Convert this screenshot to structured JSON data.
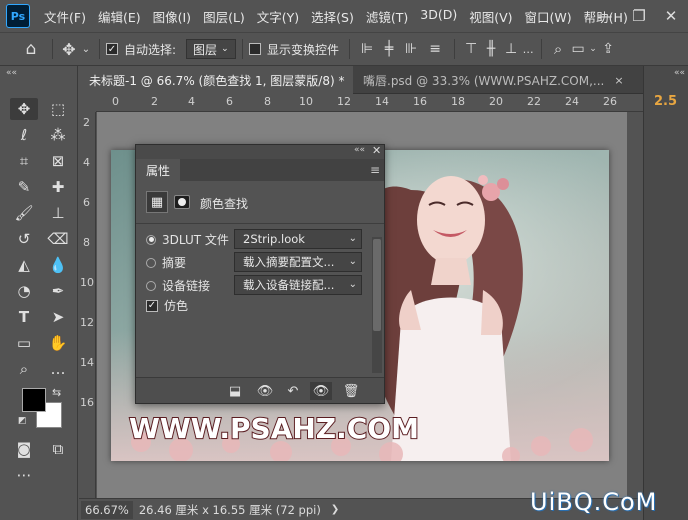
{
  "app": {
    "logo": "Ps"
  },
  "menu": [
    "文件(F)",
    "编辑(E)",
    "图像(I)",
    "图层(L)",
    "文字(Y)",
    "选择(S)",
    "滤镜(T)",
    "3D(D)",
    "视图(V)",
    "窗口(W)",
    "帮助(H)"
  ],
  "window_controls": {
    "minimize": "—",
    "maximize": "❐",
    "close": "✕"
  },
  "options": {
    "auto_select_label": "自动选择:",
    "auto_select_checked": "✓",
    "auto_select_target": "图层",
    "show_transform_label": "显示变换控件"
  },
  "tabs": [
    {
      "label": "未标题-1 @ 66.7% (颜色查找 1, 图层蒙版/8) *",
      "close": "×"
    },
    {
      "label": "嘴唇.psd @ 33.3% (WWW.PSAHZ.COM,...",
      "close": "×"
    }
  ],
  "collapse_arrows": "««",
  "ruler_h": [
    "0",
    "2",
    "4",
    "6",
    "8",
    "10",
    "12",
    "14",
    "16",
    "18",
    "20",
    "22",
    "24",
    "26"
  ],
  "ruler_v": [
    "2",
    "4",
    "6",
    "8",
    "10",
    "12",
    "14",
    "16"
  ],
  "right_panel": {
    "value": "2.5"
  },
  "properties": {
    "title": "属性",
    "adjust_name": "颜色查找",
    "options": [
      {
        "label": "3DLUT 文件",
        "value": "2Strip.look",
        "selected": true
      },
      {
        "label": "摘要",
        "value": "载入摘要配置文...",
        "selected": false
      },
      {
        "label": "设备链接",
        "value": "载入设备链接配...",
        "selected": false
      }
    ],
    "dither_label": "仿色",
    "dither_checked": "✓"
  },
  "watermark": "WWW.PSAHZ.COM",
  "status": {
    "zoom": "66.67%",
    "doc_size": "26.46 厘米 x 16.55 厘米 (72 ppi)",
    "arrow": "❯"
  },
  "corner_logo": "UiBQ.CoM",
  "colors": {
    "bg": "#535353",
    "tab_inactive": "#424242",
    "accent": "#31a8ff",
    "right_value": "#e8a641"
  }
}
